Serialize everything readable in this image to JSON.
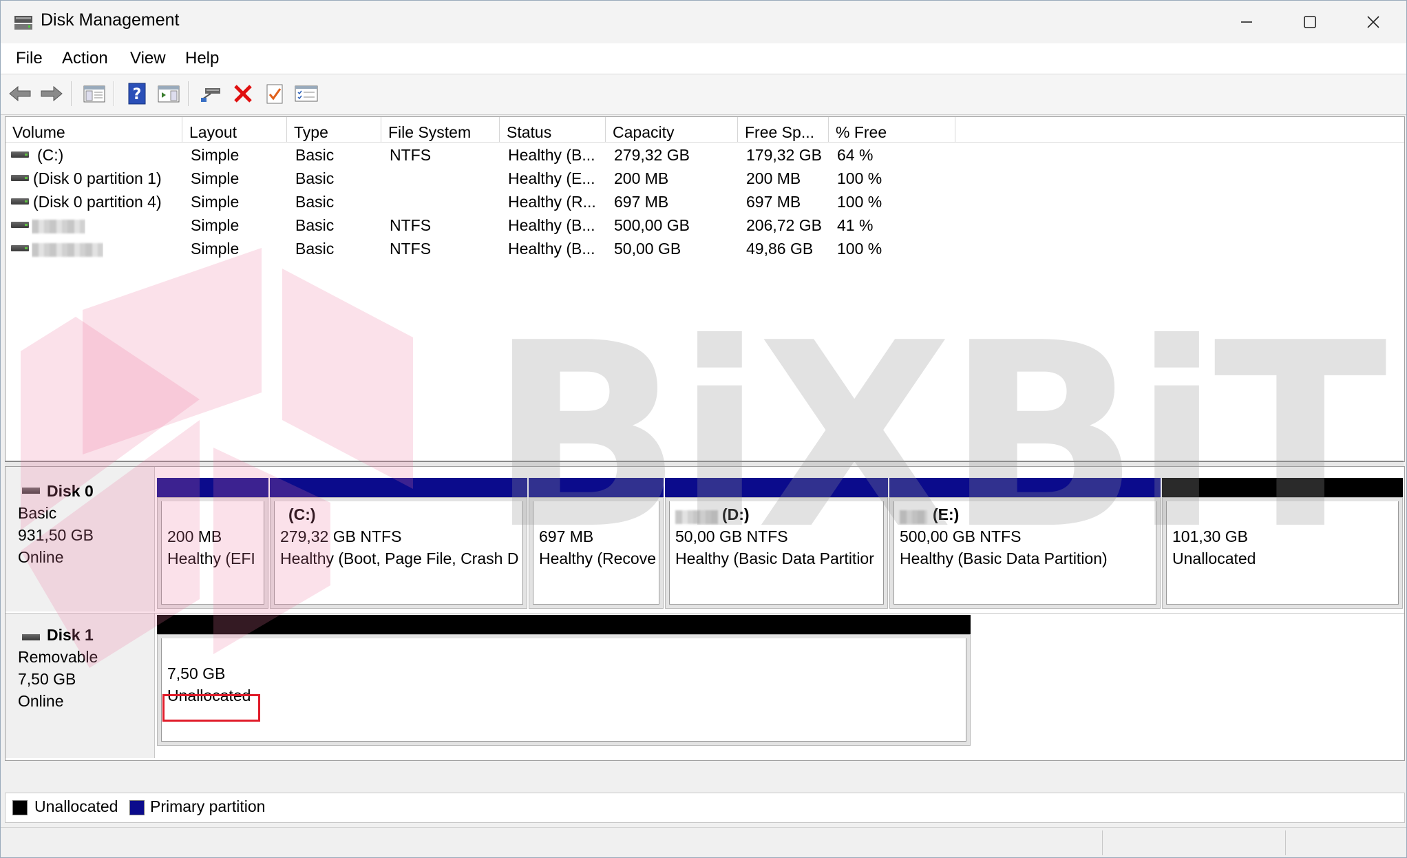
{
  "window": {
    "title": "Disk Management"
  },
  "menu": [
    "File",
    "Action",
    "View",
    "Help"
  ],
  "toolbar_icons": [
    "back-arrow-icon",
    "forward-arrow-icon",
    "console-tree-icon",
    "help-icon",
    "action-pane-icon",
    "connect-icon",
    "delete-icon",
    "checkmark-properties-icon",
    "list-view-icon"
  ],
  "volume_list": {
    "columns": [
      "Volume",
      "Layout",
      "Type",
      "File System",
      "Status",
      "Capacity",
      "Free Sp...",
      "% Free"
    ],
    "rows": [
      {
        "volume": "(C:)",
        "layout": "Simple",
        "type": "Basic",
        "fs": "NTFS",
        "status": "Healthy (B...",
        "capacity": "279,32 GB",
        "free": "179,32 GB",
        "pct": "64 %"
      },
      {
        "volume": "(Disk 0 partition 1)",
        "layout": "Simple",
        "type": "Basic",
        "fs": "",
        "status": "Healthy (E...",
        "capacity": "200 MB",
        "free": "200 MB",
        "pct": "100 %"
      },
      {
        "volume": "(Disk 0 partition 4)",
        "layout": "Simple",
        "type": "Basic",
        "fs": "",
        "status": "Healthy (R...",
        "capacity": "697 MB",
        "free": "697 MB",
        "pct": "100 %"
      },
      {
        "volume": "",
        "layout": "Simple",
        "type": "Basic",
        "fs": "NTFS",
        "status": "Healthy (B...",
        "capacity": "500,00 GB",
        "free": "206,72 GB",
        "pct": "41 %"
      },
      {
        "volume": "",
        "layout": "Simple",
        "type": "Basic",
        "fs": "NTFS",
        "status": "Healthy (B...",
        "capacity": "50,00 GB",
        "free": "49,86 GB",
        "pct": "100 %"
      }
    ]
  },
  "disks": [
    {
      "name": "Disk 0",
      "kind": "Basic",
      "size": "931,50 GB",
      "state": "Online",
      "partitions": [
        {
          "title": "",
          "line1": "200 MB",
          "line2": "Healthy (EFI",
          "kind": "primary"
        },
        {
          "title": "(C:)",
          "line1": "279,32 GB NTFS",
          "line2": "Healthy (Boot, Page File, Crash D",
          "kind": "primary"
        },
        {
          "title": "",
          "line1": "697 MB",
          "line2": "Healthy (Recove",
          "kind": "primary"
        },
        {
          "title": "(D:)",
          "line1": "50,00 GB NTFS",
          "line2": "Healthy (Basic Data Partitior",
          "kind": "primary"
        },
        {
          "title": "(E:)",
          "line1": "500,00 GB NTFS",
          "line2": "Healthy (Basic Data Partition)",
          "kind": "primary"
        },
        {
          "title": "",
          "line1": "101,30 GB",
          "line2": "Unallocated",
          "kind": "unallocated"
        }
      ]
    },
    {
      "name": "Disk 1",
      "kind": "Removable",
      "size": "7,50 GB",
      "state": "Online",
      "partitions": [
        {
          "title": "",
          "line1": "7,50 GB",
          "line2": "Unallocated",
          "kind": "unallocated"
        }
      ]
    }
  ],
  "legend": [
    {
      "label": "Unallocated",
      "color": "#000000"
    },
    {
      "label": "Primary partition",
      "color": "#0b0b8c"
    }
  ],
  "watermark": "BiXBiT",
  "colors": {
    "primary": "#0b0b8c",
    "unallocated": "#000000",
    "highlight": "#e01c2a"
  }
}
